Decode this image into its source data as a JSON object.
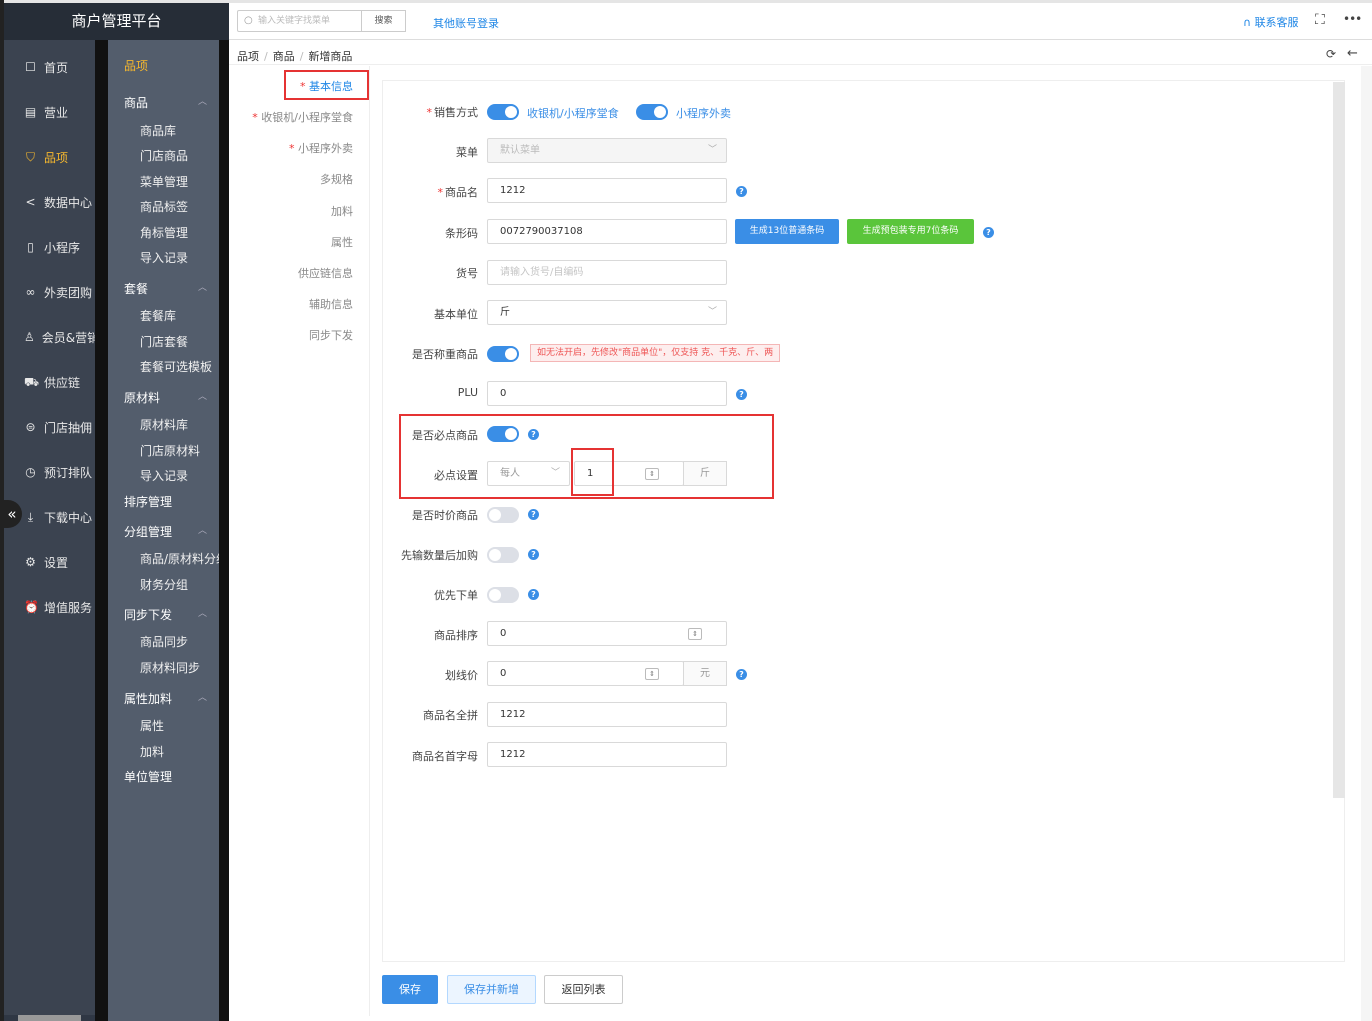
{
  "sidebar": {
    "brand": "商户管理平台",
    "nav1": [
      {
        "label": "首页",
        "icon": "home-icon"
      },
      {
        "label": "营业",
        "icon": "calendar-icon"
      },
      {
        "label": "品项",
        "icon": "bag-icon"
      },
      {
        "label": "数据中心",
        "icon": "share-icon"
      },
      {
        "label": "小程序",
        "icon": "phone-icon"
      },
      {
        "label": "外卖团购",
        "icon": "bike-icon"
      },
      {
        "label": "会员&营销",
        "icon": "user-icon"
      },
      {
        "label": "供应链",
        "icon": "truck-icon"
      },
      {
        "label": "门店抽佣",
        "icon": "coins-icon"
      },
      {
        "label": "预订排队",
        "icon": "clock-icon"
      },
      {
        "label": "下载中心",
        "icon": "download-icon"
      },
      {
        "label": "设置",
        "icon": "gear-icon"
      },
      {
        "label": "增值服务",
        "icon": "alarm-icon"
      }
    ],
    "nav2_title": "品项",
    "nav2": {
      "g1": "商品",
      "g1_items": [
        "商品库",
        "门店商品",
        "菜单管理",
        "商品标签",
        "角标管理",
        "导入记录"
      ],
      "g2": "套餐",
      "g2_items": [
        "套餐库",
        "门店套餐",
        "套餐可选模板"
      ],
      "g3": "原材料",
      "g3_items": [
        "原材料库",
        "门店原材料",
        "导入记录"
      ],
      "g4": "排序管理",
      "g5": "分组管理",
      "g5_items": [
        "商品/原材料分组",
        "财务分组"
      ],
      "g6": "同步下发",
      "g6_items": [
        "商品同步",
        "原材料同步"
      ],
      "g7": "属性加料",
      "g7_items": [
        "属性",
        "加料"
      ],
      "g8": "单位管理"
    },
    "collapse": "«"
  },
  "topbar": {
    "search_placeholder": "输入关键字找菜单",
    "search_button": "搜索",
    "other_login": "其他账号登录",
    "contact": "联系客服",
    "fullscreen": "⛶",
    "more": "•••"
  },
  "breadcrumb": [
    "品项",
    "商品",
    "新增商品"
  ],
  "tabs": [
    {
      "label": "基本信息",
      "required": true
    },
    {
      "label": "收银机/小程序堂食",
      "required": true
    },
    {
      "label": "小程序外卖",
      "required": true
    },
    {
      "label": "多规格",
      "required": false
    },
    {
      "label": "加料",
      "required": false
    },
    {
      "label": "属性",
      "required": false
    },
    {
      "label": "供应链信息",
      "required": false
    },
    {
      "label": "辅助信息",
      "required": false
    },
    {
      "label": "同步下发",
      "required": false
    }
  ],
  "form": {
    "sale_mode_label": "销售方式",
    "sale_mode_1": "收银机/小程序堂食",
    "sale_mode_2": "小程序外卖",
    "menu_label": "菜单",
    "menu_value": "默认菜单",
    "name_label": "商品名",
    "name_value": "1212",
    "barcode_label": "条形码",
    "barcode_value": "0072790037108",
    "barcode_btn_13": "生成13位普通条码",
    "barcode_btn_7": "生成预包装专用7位条码",
    "sku_label": "货号",
    "sku_placeholder": "请输入货号/自编码",
    "unit_label": "基本单位",
    "unit_value": "斤",
    "weigh_label": "是否称重商品",
    "weigh_warning": "如无法开启，先修改\"商品单位\"，仅支持 克、千克、斤、两",
    "plu_label": "PLU",
    "plu_value": "0",
    "must_label": "是否必点商品",
    "must_setting_label": "必点设置",
    "must_per": "每人",
    "must_qty": "1",
    "must_unit": "斤",
    "seasonal_label": "是否时价商品",
    "input_qty_label": "先输数量后加购",
    "priority_label": "优先下单",
    "sort_label": "商品排序",
    "sort_value": "0",
    "strike_label": "划线价",
    "strike_value": "0",
    "strike_unit": "元",
    "pinyin_label": "商品名全拼",
    "pinyin_value": "1212",
    "initial_label": "商品名首字母",
    "initial_value": "1212"
  },
  "footer": {
    "save": "保存",
    "save_new": "保存并新增",
    "back": "返回列表"
  }
}
